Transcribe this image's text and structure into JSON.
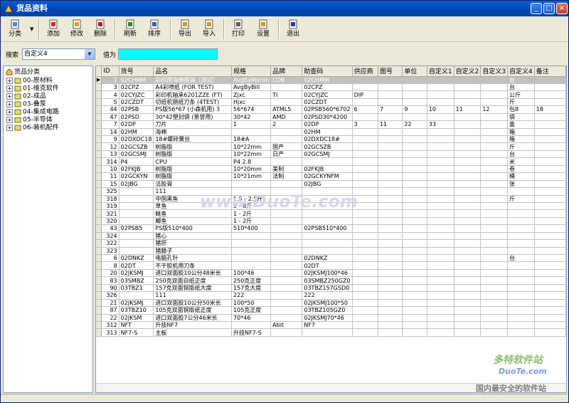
{
  "window": {
    "title": "货品资料"
  },
  "toolbar": {
    "buttons": [
      {
        "label": "分类",
        "icon": "category-icon"
      },
      {
        "label": "添加",
        "icon": "add-icon"
      },
      {
        "label": "修改",
        "icon": "edit-icon"
      },
      {
        "label": "删除",
        "icon": "delete-icon"
      },
      {
        "label": "刷新",
        "icon": "refresh-icon"
      },
      {
        "label": "排序",
        "icon": "sort-icon"
      },
      {
        "label": "导出",
        "icon": "export-icon"
      },
      {
        "label": "导入",
        "icon": "import-icon"
      },
      {
        "label": "打印",
        "icon": "print-icon"
      },
      {
        "label": "设置",
        "icon": "settings-icon"
      },
      {
        "label": "退出",
        "icon": "exit-icon"
      }
    ]
  },
  "search": {
    "label": "搜索",
    "field": "自定义4",
    "value_label": "值为",
    "value": ""
  },
  "tree": {
    "root": "货品分类",
    "items": [
      "00-原材料",
      "01-维克软件",
      "02-成品",
      "03-叠泵",
      "04-集成电路",
      "05-半导体",
      "06-装机配件"
    ]
  },
  "grid": {
    "columns": [
      "ID",
      "货号",
      "品名",
      "规格",
      "品牌",
      "助查码",
      "供应商",
      "图号",
      "单位",
      "自定义1",
      "自定义2",
      "自定义3",
      "自定义4",
      "备注"
    ],
    "rows": [
      [
        "1",
        "02CHMM",
        "彩印用海绵擦镐（测试）",
        "AvgByMonth",
        "COB",
        "02CHMM",
        "",
        "",
        "",
        "",
        "",
        "",
        "台",
        ""
      ],
      [
        "3",
        "02CPZ",
        "A4彩喷纸 (FOR TEST)",
        "AvgByBill",
        "",
        "02CPZ",
        "",
        "",
        "",
        "",
        "",
        "",
        "台",
        ""
      ],
      [
        "4",
        "02CYJZC",
        "彩印机轴承6201ZZE (FT)",
        "Zjxc",
        "TI",
        "02CYJZC",
        "DIP",
        "",
        "",
        "",
        "",
        "",
        "公斤",
        ""
      ],
      [
        "5",
        "02CZDT",
        "切纸机铡纸刀条 (4TEST)",
        "Hjxc",
        "",
        "02CZDT",
        "",
        "",
        "",
        "",
        "",
        "",
        "斤",
        ""
      ],
      [
        "44",
        "02PSB",
        "PS版56*67 (小森机用) 3",
        "56*674",
        "ATML5",
        "02PSB560*6702",
        "6",
        "7",
        "9",
        "10",
        "11",
        "12",
        "包8",
        "18"
      ],
      [
        "47",
        "02PSD",
        "30*42塑封袋 (景誉用)",
        "30*42",
        "AMD",
        "02PSD30*4200",
        "",
        "",
        "",
        "",
        "",
        "",
        "袋",
        ""
      ],
      [
        "7",
        "02DP",
        "刀片",
        "1",
        "2",
        "02DP",
        "3",
        "11",
        "22",
        "33",
        "",
        "",
        "盒",
        ""
      ],
      [
        "14",
        "02HM",
        "海棉",
        "",
        "",
        "02HM",
        "",
        "",
        "",
        "",
        "",
        "",
        "箱",
        ""
      ],
      [
        "9",
        "02DXDC18",
        "18#螺碎簧丝",
        "18#A",
        "",
        "02DXDC18#",
        "",
        "",
        "",
        "",
        "",
        "",
        "箱",
        ""
      ],
      [
        "12",
        "02GCSZB",
        "树脂版",
        "10*22mm",
        "国产",
        "02GCSZB",
        "",
        "",
        "",
        "",
        "",
        "",
        "斤",
        ""
      ],
      [
        "13",
        "02GCSMJ",
        "树脂版",
        "10*22mm",
        "日产",
        "02GCSMJ",
        "",
        "",
        "",
        "",
        "",
        "",
        "台",
        ""
      ],
      [
        "314",
        "P4",
        "CPU",
        "P4 2.8",
        "",
        "",
        "",
        "",
        "",
        "",
        "",
        "",
        "米",
        ""
      ],
      [
        "10",
        "02FKJB",
        "树脂版",
        "10*20mm",
        "美制",
        "02FKJB",
        "",
        "",
        "",
        "",
        "",
        "",
        "卷",
        ""
      ],
      [
        "11",
        "02GCKYN",
        "树脂版",
        "10*21mm",
        "法制",
        "02GCKYNFM",
        "",
        "",
        "",
        "",
        "",
        "",
        "桶",
        ""
      ],
      [
        "15",
        "02JBG",
        "洁胶膏",
        "",
        "",
        "02JBG",
        "",
        "",
        "",
        "",
        "",
        "",
        "张",
        ""
      ],
      [
        "325",
        "",
        "111",
        "",
        "",
        "",
        "",
        "",
        "",
        "",
        "",
        "",
        "",
        ""
      ],
      [
        "318",
        "",
        "中国黑鱼",
        "1.5 - 2.5斤",
        "",
        "",
        "",
        "",
        "",
        "",
        "",
        "",
        "斤",
        ""
      ],
      [
        "319",
        "",
        "草鱼",
        "5 - 8斤",
        "",
        "",
        "",
        "",
        "",
        "",
        "",
        "",
        "",
        ""
      ],
      [
        "321",
        "",
        "鲢鱼",
        "1 - 2斤",
        "",
        "",
        "",
        "",
        "",
        "",
        "",
        "",
        "",
        ""
      ],
      [
        "320",
        "",
        "鲫鱼",
        "1 - 2斤",
        "",
        "",
        "",
        "",
        "",
        "",
        "",
        "",
        "",
        ""
      ],
      [
        "43",
        "02PSB5",
        "PS版510*400",
        "510*400",
        "",
        "02PSB510*400",
        "",
        "",
        "",
        "",
        "",
        "",
        "",
        ""
      ],
      [
        "324",
        "",
        "猪心",
        "",
        "",
        "",
        "",
        "",
        "",
        "",
        "",
        "",
        "",
        ""
      ],
      [
        "322",
        "",
        "猪肝",
        "",
        "",
        "",
        "",
        "",
        "",
        "",
        "",
        "",
        "",
        ""
      ],
      [
        "323",
        "",
        "猪腰子",
        "",
        "",
        "",
        "",
        "",
        "",
        "",
        "",
        "",
        "",
        ""
      ],
      [
        "6",
        "02DNKZ",
        "电脑孔针",
        "",
        "",
        "02DNKZ",
        "",
        "",
        "",
        "",
        "",
        "",
        "台",
        ""
      ],
      [
        "8",
        "02DT",
        "不干胶机用刀条",
        "",
        "",
        "02DT",
        "",
        "",
        "",
        "",
        "",
        "",
        "",
        ""
      ],
      [
        "20",
        "02JKSMJ",
        "进口双面胶10公分48米长",
        "100*46",
        "",
        "02JKSMJ100*46",
        "",
        "",
        "",
        "",
        "",
        "",
        "",
        ""
      ],
      [
        "83",
        "03SMBZ",
        "250克双面白纸正度",
        "250克正度",
        "",
        "03SMBZ250GZ0",
        "",
        "",
        "",
        "",
        "",
        "",
        "",
        ""
      ],
      [
        "90",
        "03TBZ1",
        "157克双面铜版纸大度",
        "157克大度",
        "",
        "03TBZ157GSD0",
        "",
        "",
        "",
        "",
        "",
        "",
        "",
        ""
      ],
      [
        "326",
        "",
        "111",
        "222",
        "",
        "222",
        "",
        "",
        "",
        "",
        "",
        "",
        "",
        ""
      ],
      [
        "21",
        "02JKSMJ",
        "进口双面胶10公分50米长",
        "100*50",
        "",
        "02JKSMJ100*50",
        "",
        "",
        "",
        "",
        "",
        "",
        "",
        ""
      ],
      [
        "87",
        "03TBZ10",
        "105克双面铜版纸正度",
        "105克正度",
        "",
        "03TBZ105GZ0",
        "",
        "",
        "",
        "",
        "",
        "",
        "",
        ""
      ],
      [
        "22",
        "02JKSM",
        "进口双面胶7公分46米长",
        "70*46",
        "",
        "02JKSMJ70*46",
        "",
        "",
        "",
        "",
        "",
        "",
        "",
        ""
      ],
      [
        "312",
        "NFT",
        "升技NF7",
        "",
        "Abit",
        "NF7",
        "",
        "",
        "",
        "",
        "",
        "",
        "",
        ""
      ],
      [
        "313",
        "NF7-S",
        "主板",
        "升技NF7-S",
        "",
        "",
        "",
        "",
        "",
        "",
        "",
        "",
        "",
        ""
      ]
    ]
  },
  "watermarks": {
    "center": "www.DuoTe.com",
    "brand_cn": "多特软件站",
    "brand_en": "DuoTe.com",
    "slogan": "国内最安全的软件站"
  }
}
